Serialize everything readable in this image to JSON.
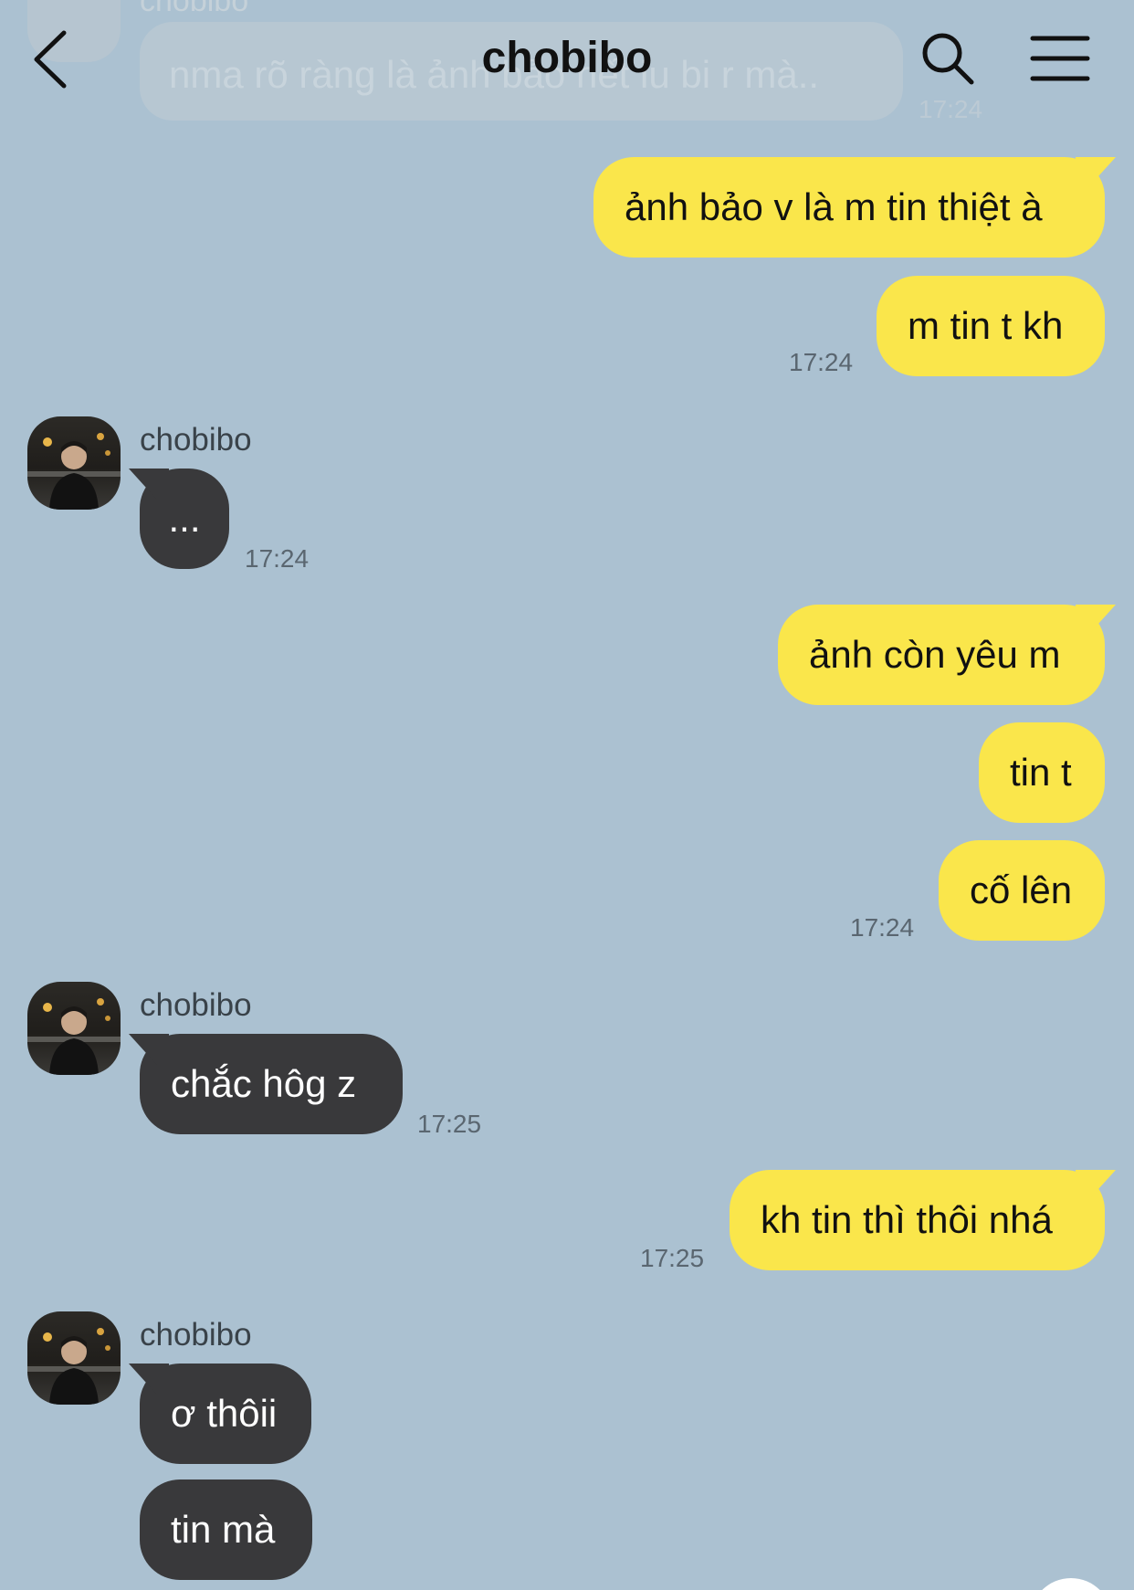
{
  "header": {
    "title": "chobibo"
  },
  "faded_message": {
    "sender": "chobibo",
    "text": "nma rõ ràng là ảnh bảo hết iu bi r mà..",
    "time": "17:24"
  },
  "messages": [
    {
      "from": "me",
      "text": "ảnh bảo v là m tin thiệt à"
    },
    {
      "from": "me",
      "text": "m tin t kh",
      "time": "17:24"
    },
    {
      "from": "them",
      "sender": "chobibo",
      "text": "...",
      "time": "17:24"
    },
    {
      "from": "me",
      "text": "ảnh còn yêu m"
    },
    {
      "from": "me",
      "text": "tin t"
    },
    {
      "from": "me",
      "text": "cố lên",
      "time": "17:24"
    },
    {
      "from": "them",
      "sender": "chobibo",
      "text": "chắc hôg z",
      "time": "17:25"
    },
    {
      "from": "me",
      "text": "kh tin thì thôi nhá",
      "time": "17:25"
    },
    {
      "from": "them",
      "sender": "chobibo",
      "text": "ơ thôii"
    },
    {
      "from": "them",
      "text": "tin mà"
    }
  ],
  "colors": {
    "background": "#abc1d1",
    "my_bubble": "#fae64b",
    "their_bubble": "#39393b"
  },
  "icons": [
    "back-arrow-icon",
    "search-icon",
    "menu-icon"
  ]
}
